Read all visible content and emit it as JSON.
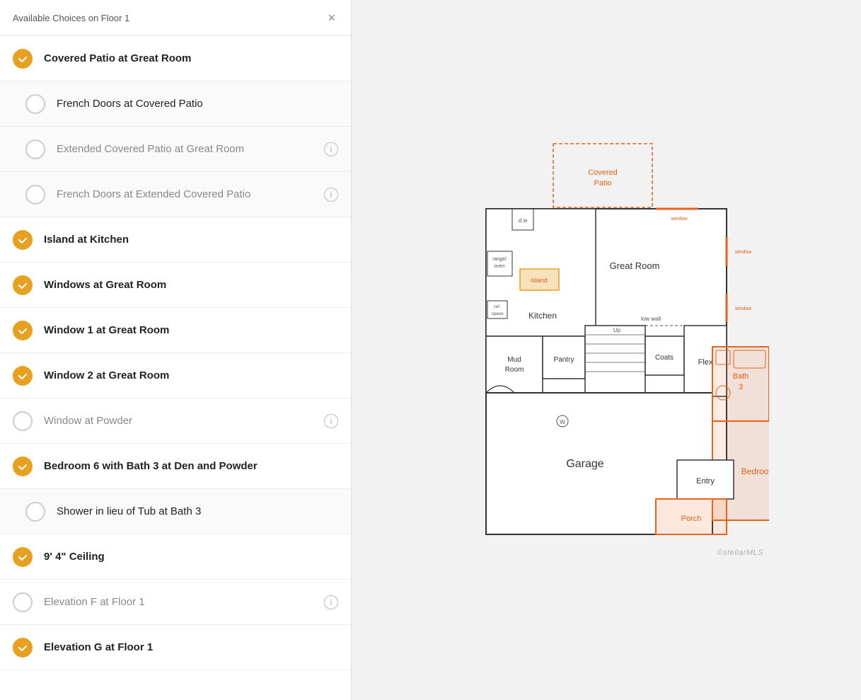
{
  "panel": {
    "title": "Available Choices on Floor 1",
    "close_label": "×"
  },
  "choices": [
    {
      "id": "covered-patio",
      "label": "Covered Patio at Great Room",
      "checked": true,
      "sub": false,
      "muted": false,
      "info": false
    },
    {
      "id": "french-doors-covered",
      "label": "French Doors at Covered Patio",
      "checked": false,
      "sub": true,
      "muted": false,
      "info": false
    },
    {
      "id": "extended-covered-patio",
      "label": "Extended Covered Patio at Great Room",
      "checked": false,
      "sub": true,
      "muted": true,
      "info": true
    },
    {
      "id": "french-doors-extended",
      "label": "French Doors at Extended Covered Patio",
      "checked": false,
      "sub": true,
      "muted": true,
      "info": true
    },
    {
      "id": "island-kitchen",
      "label": "Island at Kitchen",
      "checked": true,
      "sub": false,
      "muted": false,
      "info": false
    },
    {
      "id": "windows-great-room",
      "label": "Windows at Great Room",
      "checked": true,
      "sub": false,
      "muted": false,
      "info": false
    },
    {
      "id": "window1-great-room",
      "label": "Window 1 at Great Room",
      "checked": true,
      "sub": false,
      "muted": false,
      "info": false
    },
    {
      "id": "window2-great-room",
      "label": "Window 2 at Great Room",
      "checked": true,
      "sub": false,
      "muted": false,
      "info": false
    },
    {
      "id": "window-powder",
      "label": "Window at Powder",
      "checked": false,
      "sub": false,
      "muted": true,
      "info": true
    },
    {
      "id": "bedroom6-bath3",
      "label": "Bedroom 6 with Bath 3 at Den and Powder",
      "checked": true,
      "sub": false,
      "muted": false,
      "info": false
    },
    {
      "id": "shower-tub",
      "label": "Shower in lieu of Tub at Bath 3",
      "checked": false,
      "sub": true,
      "muted": false,
      "info": false
    },
    {
      "id": "ceiling",
      "label": "9' 4\" Ceiling",
      "checked": true,
      "sub": false,
      "muted": false,
      "info": false
    },
    {
      "id": "elevation-f",
      "label": "Elevation F at Floor 1",
      "checked": false,
      "sub": false,
      "muted": true,
      "info": true
    },
    {
      "id": "elevation-g",
      "label": "Elevation G at Floor 1",
      "checked": true,
      "sub": false,
      "muted": false,
      "info": false
    }
  ],
  "floorplan": {
    "watermark": "©stellarMLS"
  }
}
